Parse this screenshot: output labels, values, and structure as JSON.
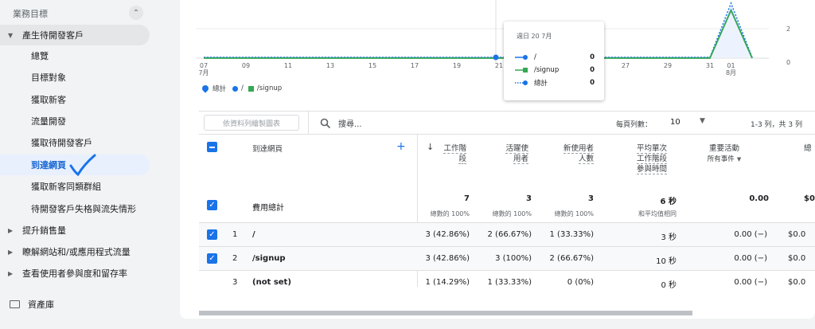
{
  "sidebar": {
    "section_title": "業務目標",
    "groups": [
      {
        "label": "產生待開發客戶",
        "items": [
          "總覽",
          "目標對象",
          "獲取新客",
          "流量開發",
          "獲取待開發客戶",
          "到達網頁",
          "獲取新客同類群組",
          "待開發客戶失格與流失情形"
        ]
      },
      {
        "label": "提升銷售量"
      },
      {
        "label": "瞭解網站和/或應用程式流量"
      },
      {
        "label": "查看使用者參與度和留存率"
      }
    ],
    "library": "資產庫"
  },
  "chart": {
    "x_ticks": [
      "07\n7月",
      "09",
      "11",
      "13",
      "15",
      "17",
      "19",
      "21",
      "23",
      "25",
      "27",
      "29",
      "31",
      "01\n8月"
    ],
    "y_ticks": [
      "2",
      "0"
    ],
    "legend": {
      "total": "總計",
      "s1": "/",
      "s2": "/signup"
    },
    "colors": {
      "total": "#1a73e8",
      "s1": "#1a73e8",
      "s2": "#34a853"
    }
  },
  "chart_data": {
    "type": "line",
    "x": [
      "07/07",
      "07/08",
      "07/09",
      "07/10",
      "07/11",
      "07/12",
      "07/13",
      "07/14",
      "07/15",
      "07/16",
      "07/17",
      "07/18",
      "07/19",
      "07/20",
      "07/21",
      "07/22",
      "07/23",
      "07/24",
      "07/25",
      "07/26",
      "07/27",
      "07/28",
      "07/29",
      "07/30",
      "07/31",
      "08/01",
      "08/02"
    ],
    "series": [
      {
        "name": "總計",
        "values": [
          0,
          0,
          0,
          0,
          0,
          0,
          0,
          0,
          0,
          0,
          0,
          0,
          0,
          0,
          0,
          0,
          0,
          0,
          0,
          0,
          0,
          0,
          0,
          0,
          0,
          7,
          0
        ]
      },
      {
        "name": "/",
        "values": [
          0,
          0,
          0,
          0,
          0,
          0,
          0,
          0,
          0,
          0,
          0,
          0,
          0,
          0,
          0,
          0,
          0,
          0,
          0,
          0,
          0,
          0,
          0,
          0,
          0,
          3,
          0
        ]
      },
      {
        "name": "/signup",
        "values": [
          0,
          0,
          0,
          0,
          0,
          0,
          0,
          0,
          0,
          0,
          0,
          0,
          0,
          0,
          0,
          0,
          0,
          0,
          0,
          0,
          0,
          0,
          0,
          0,
          0,
          3,
          0
        ]
      }
    ],
    "ylim": [
      0,
      3.4
    ]
  },
  "tooltip": {
    "title": "週日 20 7月",
    "rows": [
      {
        "label": "/",
        "value": "0"
      },
      {
        "label": "/signup",
        "value": "0"
      },
      {
        "label": "總計",
        "value": "0"
      }
    ]
  },
  "toolbar": {
    "chart_button": "依資料列繪製圖表",
    "search_placeholder": "搜尋...",
    "rows_per_page_label": "每頁列數：",
    "rows_per_page_value": "10",
    "range": "1-3 列，共 3 列"
  },
  "table": {
    "dimension_header": "到達網頁",
    "columns": [
      {
        "l1": "工作階",
        "l2": "段"
      },
      {
        "l1": "活躍使",
        "l2": "用者"
      },
      {
        "l1": "新使用者",
        "l2": "人數"
      },
      {
        "l1": "平均單次",
        "l2": "工作階段",
        "l3": "參與時間"
      },
      {
        "l1": "重要活動",
        "l2": "所有事件"
      },
      {
        "l1": "總"
      }
    ],
    "totals": {
      "label": "費用總計",
      "values": [
        "7",
        "3",
        "3",
        "6 秒",
        "0.00",
        "$0"
      ],
      "subs": [
        "總數的 100%",
        "總數的 100%",
        "總數的 100%",
        "和平均值相同",
        "",
        ""
      ]
    },
    "rows": [
      {
        "idx": "1",
        "page": "/",
        "cells": [
          "3 (42.86%)",
          "2 (66.67%)",
          "1 (33.33%)",
          "3 秒",
          "0.00 (−)",
          "$0.0"
        ]
      },
      {
        "idx": "2",
        "page": "/signup",
        "cells": [
          "3 (42.86%)",
          "3 (100%)",
          "2 (66.67%)",
          "10 秒",
          "0.00 (−)",
          "$0.0"
        ]
      },
      {
        "idx": "3",
        "page": "(not set)",
        "cells": [
          "1 (14.29%)",
          "1 (33.33%)",
          "0 (0%)",
          "0 秒",
          "0.00 (−)",
          "$0.0"
        ]
      }
    ]
  }
}
